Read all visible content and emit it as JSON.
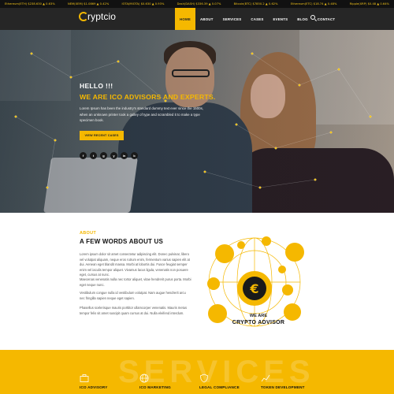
{
  "ticker": [
    "Ethereum(ETH) $238.630 ▲ 0.63%",
    "NEM(XEM) $1.0869 ▲ 0.42%",
    "IOTA(MIOTA) $0.630 ▲ 0.93%",
    "Dash(DASH) $336.39 ▲ 0.07%",
    "Bitcoin(BTC) $7850.2 ▲ 0.62%",
    "Ethereum(ETC) $18.74 ▲ 0.48%",
    "Ripple(XRP) $0.48 ▲ 0.64%"
  ],
  "header": {
    "logo_text": "ryptcio",
    "nav": [
      "HOME",
      "ABOUT",
      "SERVICES",
      "CASES",
      "EVENTS",
      "BLOG",
      "CONTACT"
    ]
  },
  "hero": {
    "hello": "HELLO !!!",
    "headline": "WE ARE ICO ADVISORS AND EXPERTS.",
    "paragraph": "Lorem Ipsum has been the industry's standard dummy text ever since the 1500s, when an unknown printer took a galley of type and scrambled it to make a type specimen book.",
    "cta": "VIEW RECENT CASES",
    "socials": [
      "f",
      "t",
      "g",
      "y",
      "in",
      "b"
    ]
  },
  "about": {
    "label": "ABOUT",
    "title": "A FEW WORDS ABOUT US",
    "paragraphs": [
      "Lorem ipsum dolor sit amet consectetur adipiscing elit. Donec pulvinar, libero vel volutpat aliquam, neque eros rutrum enim, fermentum varius sapien elit at dui. Aenean eget blandit massa. Morbi at lobortis dui. Fusce feugiat semper enim vel iaculis tempor aliquet. Vivamus lacus ligula, venenatis non posuere eget, cursus at nunc.",
      "Maecenas venenatis nulla nec tortor aliquet, vitae hendrerit purus porta. Morbi eget neque nunc.",
      "Vestibulum congue nulla id vestibulum volutpat. Nam augue hendrerit arcu nec fringilla sapien neque eget sapien.",
      "Phasellus scelerisque mauris porttitor ullamcorper venenatis. Mauris metus tempor felis sit amet suscipit quam cursus at dui. Nulla eleifend interdum."
    ],
    "diagram_caption1": "WE ARE",
    "diagram_caption2": "CRYPTO ADVISOR"
  },
  "services": {
    "background_word": "SERVICES",
    "items": [
      {
        "label": "ICO ADVISORY",
        "icon": "briefcase-icon"
      },
      {
        "label": "ICO MARKETING",
        "icon": "globe-icon"
      },
      {
        "label": "LEGAL COMPLIANCE",
        "icon": "shield-icon"
      },
      {
        "label": "TOKEN DEVELOPMENT",
        "icon": "chart-icon"
      }
    ]
  },
  "colors": {
    "accent": "#f5b800",
    "dark": "#262626"
  }
}
